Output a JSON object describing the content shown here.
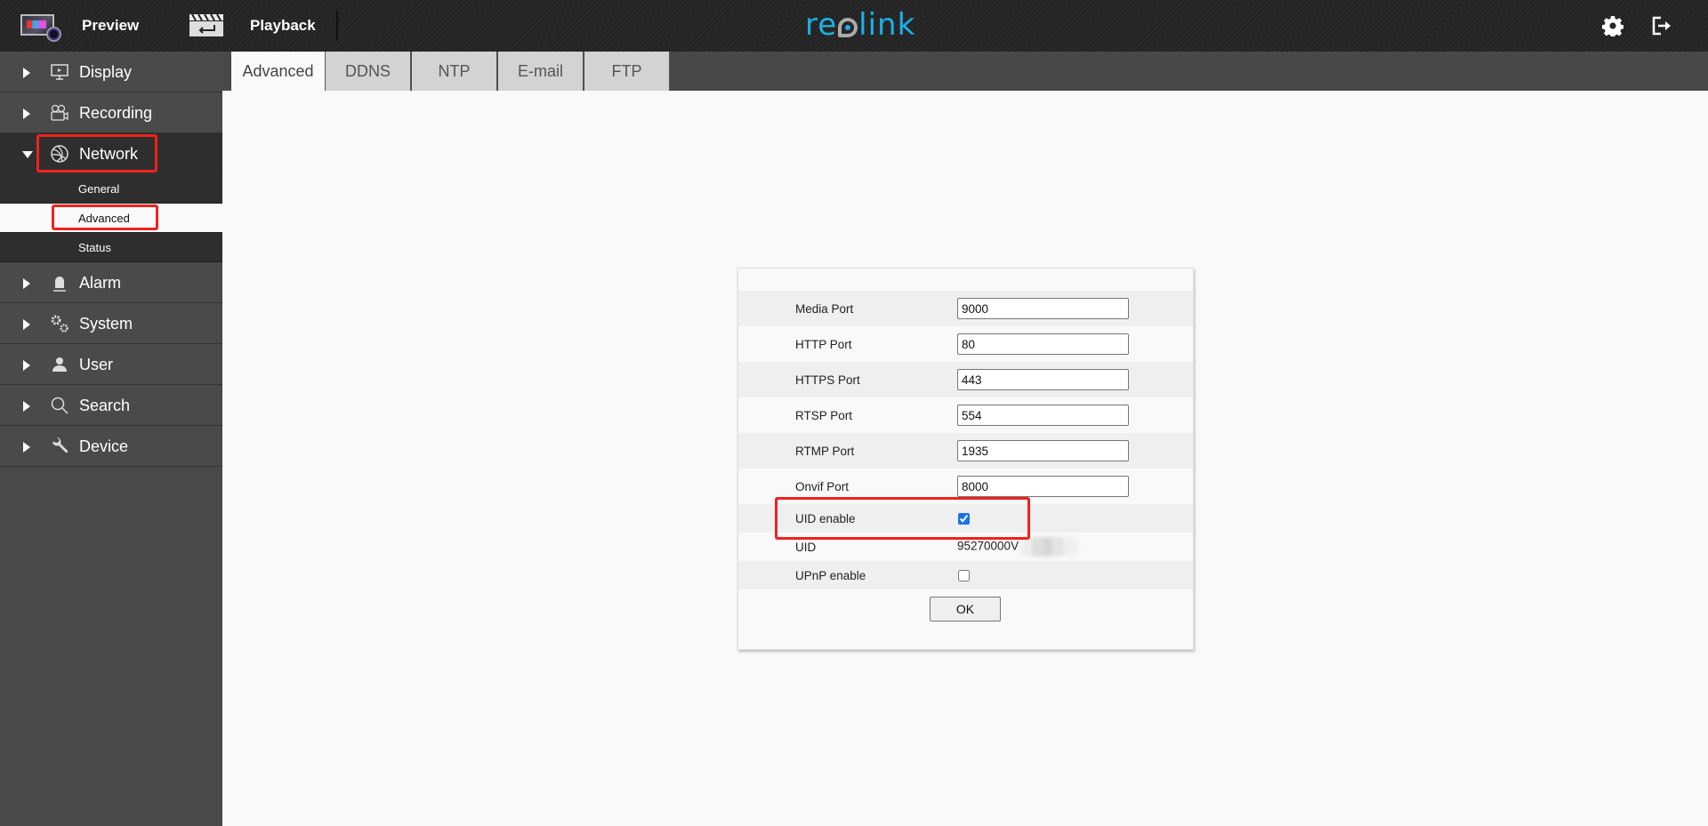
{
  "header": {
    "preview_label": "Preview",
    "playback_label": "Playback",
    "logo_text_a": "re",
    "logo_text_b": "link",
    "settings_icon": "gear-icon",
    "logout_icon": "logout-icon"
  },
  "sidebar": {
    "items": [
      {
        "label": "Display",
        "icon": "monitor-icon",
        "expanded": false
      },
      {
        "label": "Recording",
        "icon": "video-camera-icon",
        "expanded": false
      },
      {
        "label": "Network",
        "icon": "network-globe-icon",
        "expanded": true,
        "children": [
          {
            "label": "General",
            "active": false
          },
          {
            "label": "Advanced",
            "active": true
          },
          {
            "label": "Status",
            "active": false
          }
        ]
      },
      {
        "label": "Alarm",
        "icon": "alarm-siren-icon",
        "expanded": false
      },
      {
        "label": "System",
        "icon": "gears-icon",
        "expanded": false
      },
      {
        "label": "User",
        "icon": "user-icon",
        "expanded": false
      },
      {
        "label": "Search",
        "icon": "search-icon",
        "expanded": false
      },
      {
        "label": "Device",
        "icon": "wrench-icon",
        "expanded": false
      }
    ]
  },
  "tabs": [
    {
      "label": "Advanced",
      "active": true
    },
    {
      "label": "DDNS",
      "active": false
    },
    {
      "label": "NTP",
      "active": false
    },
    {
      "label": "E-mail",
      "active": false
    },
    {
      "label": "FTP",
      "active": false
    }
  ],
  "form": {
    "fields": [
      {
        "label": "Media Port",
        "value": "9000"
      },
      {
        "label": "HTTP Port",
        "value": "80"
      },
      {
        "label": "HTTPS Port",
        "value": "443"
      },
      {
        "label": "RTSP Port",
        "value": "554"
      },
      {
        "label": "RTMP Port",
        "value": "1935"
      },
      {
        "label": "Onvif Port",
        "value": "8000"
      }
    ],
    "uid_enable": {
      "label": "UID enable",
      "checked": true
    },
    "uid": {
      "label": "UID",
      "value": "95270000V"
    },
    "upnp_enable": {
      "label": "UPnP enable",
      "checked": false
    },
    "ok_label": "OK"
  },
  "colors": {
    "brand": "#1ab0e8",
    "highlight": "#f2211c",
    "sidebar_bg": "#4a4a4a",
    "sidebar_open_bg": "#2e2e2e"
  }
}
